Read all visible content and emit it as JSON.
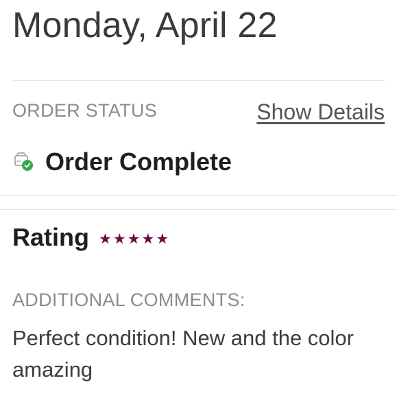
{
  "header": {
    "date": "Monday, April 22"
  },
  "order_status": {
    "label": "ORDER STATUS",
    "show_details_label": "Show Details",
    "status_text": "Order Complete",
    "status_icon": "box-check-icon",
    "status_icon_color": "#3aa552"
  },
  "rating": {
    "label": "Rating",
    "stars": 5,
    "max_stars": 5,
    "star_color": "#6e0a43"
  },
  "comments": {
    "label": "ADDITIONAL COMMENTS:",
    "text": "Perfect condition! New and the color amazing"
  }
}
